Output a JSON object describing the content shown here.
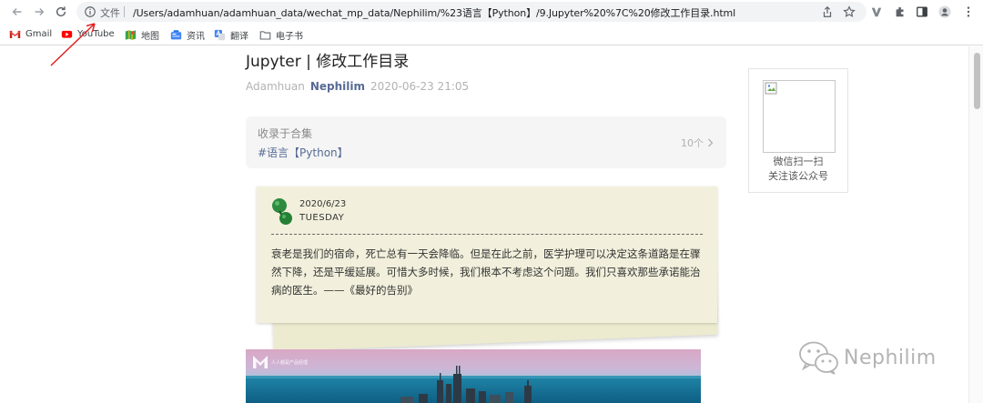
{
  "browser": {
    "omnibox": {
      "file_label": "文件",
      "url": "/Users/adamhuan/adamhuan_data/wechat_mp_data/Nephilim/%23语言【Python】/9.Jupyter%20%7C%20修改工作目录.html"
    },
    "icons": {
      "back": "arrow-left-icon",
      "forward": "arrow-right-icon",
      "reload": "reload-icon",
      "info": "info-icon",
      "share": "share-icon",
      "bookmark": "star-icon",
      "extension_1": "vivaldi-v-icon",
      "extension_2": "puzzle-icon",
      "sidepanel": "side-panel-icon",
      "profile": "avatar-icon",
      "menu": "kebab-menu-icon"
    },
    "bookmarks": [
      {
        "label": "Gmail",
        "icon": "gmail-icon"
      },
      {
        "label": "YouTube",
        "icon": "youtube-icon"
      },
      {
        "label": "地图",
        "icon": "maps-icon"
      },
      {
        "label": "资讯",
        "icon": "news-icon"
      },
      {
        "label": "翻译",
        "icon": "translate-icon"
      },
      {
        "label": "电子书",
        "icon": "folder-icon"
      }
    ]
  },
  "article": {
    "title": "Jupyter | 修改工作目录",
    "author": "Adamhuan",
    "account": "Nephilim",
    "date": "2020-06-23 21:05",
    "collection": {
      "label": "收录于合集",
      "tag": "#语言【Python】",
      "count": "10个"
    },
    "note": {
      "date": "2020/6/23",
      "weekday": "TUESDAY",
      "quote": "衰老是我们的宿命，死亡总有一天会降临。但是在此之前，医学护理可以决定这条道路是在骤然下降，还是平缓延展。可惜大多时候，我们根本不考虑这个问题。我们只喜欢那些承诺能治病的医生。——《最好的告别》"
    },
    "photo_logo_text": "人人都是产品经理"
  },
  "sidebar": {
    "qr_line1": "微信扫一扫",
    "qr_line2": "关注该公众号"
  },
  "watermark": {
    "text": "Nephilim"
  },
  "colors": {
    "link": "#576b95",
    "note_paper": "#f2f0dc",
    "pin": "#2e8b3e",
    "annotation_arrow": "#e02020"
  }
}
